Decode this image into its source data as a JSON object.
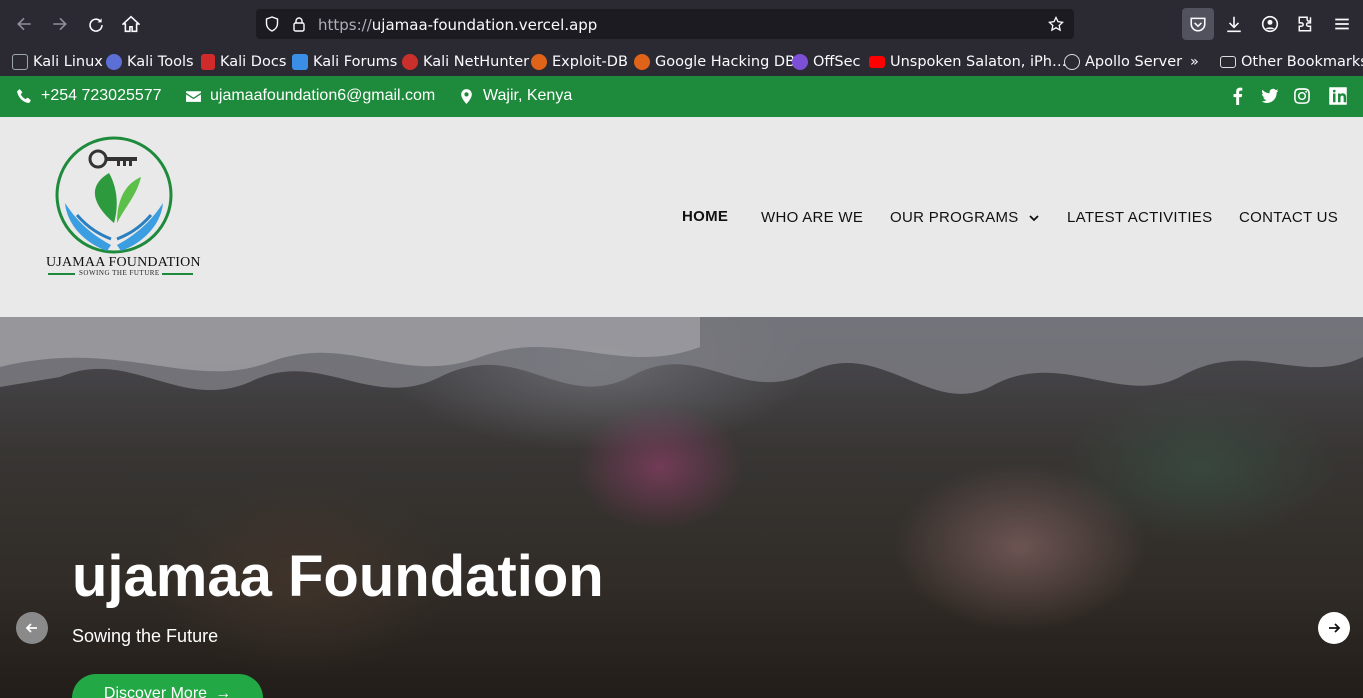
{
  "browser": {
    "url_scheme": "https://",
    "url_host": "ujamaa-foundation.vercel.app",
    "bookmarks": [
      {
        "label": "Kali Linux",
        "color": "#3b82c4"
      },
      {
        "label": "Kali Tools",
        "color": "#5b6fd6"
      },
      {
        "label": "Kali Docs",
        "color": "#d12a2a"
      },
      {
        "label": "Kali Forums",
        "color": "#3a8ee6"
      },
      {
        "label": "Kali NetHunter",
        "color": "#c9302c"
      },
      {
        "label": "Exploit-DB",
        "color": "#e0631a"
      },
      {
        "label": "Google Hacking DB",
        "color": "#e0631a"
      },
      {
        "label": "OffSec",
        "color": "#7b4fd6"
      },
      {
        "label": "Unspoken Salaton, iPh…",
        "color": "#ff0000"
      },
      {
        "label": "Apollo Server Vs",
        "color": "#cccccc"
      }
    ],
    "other_bookmarks": "Other Bookmarks"
  },
  "infobar": {
    "phone": "+254 723025577",
    "email": "ujamaafoundation6@gmail.com",
    "location": "Wajir, Kenya",
    "bg_color": "#1e8a3b"
  },
  "logo": {
    "title": "UJAMAA FOUNDATION",
    "tagline": "SOWING THE FUTURE"
  },
  "nav": {
    "home": "HOME",
    "who": "WHO ARE WE",
    "programs": "OUR PROGRAMS",
    "activities": "LATEST ACTIVITIES",
    "contact": "CONTACT US"
  },
  "hero": {
    "title": "ujamaa Foundation",
    "subtitle": "Sowing the Future",
    "cta": "Discover More",
    "cta_color": "#22a845"
  }
}
